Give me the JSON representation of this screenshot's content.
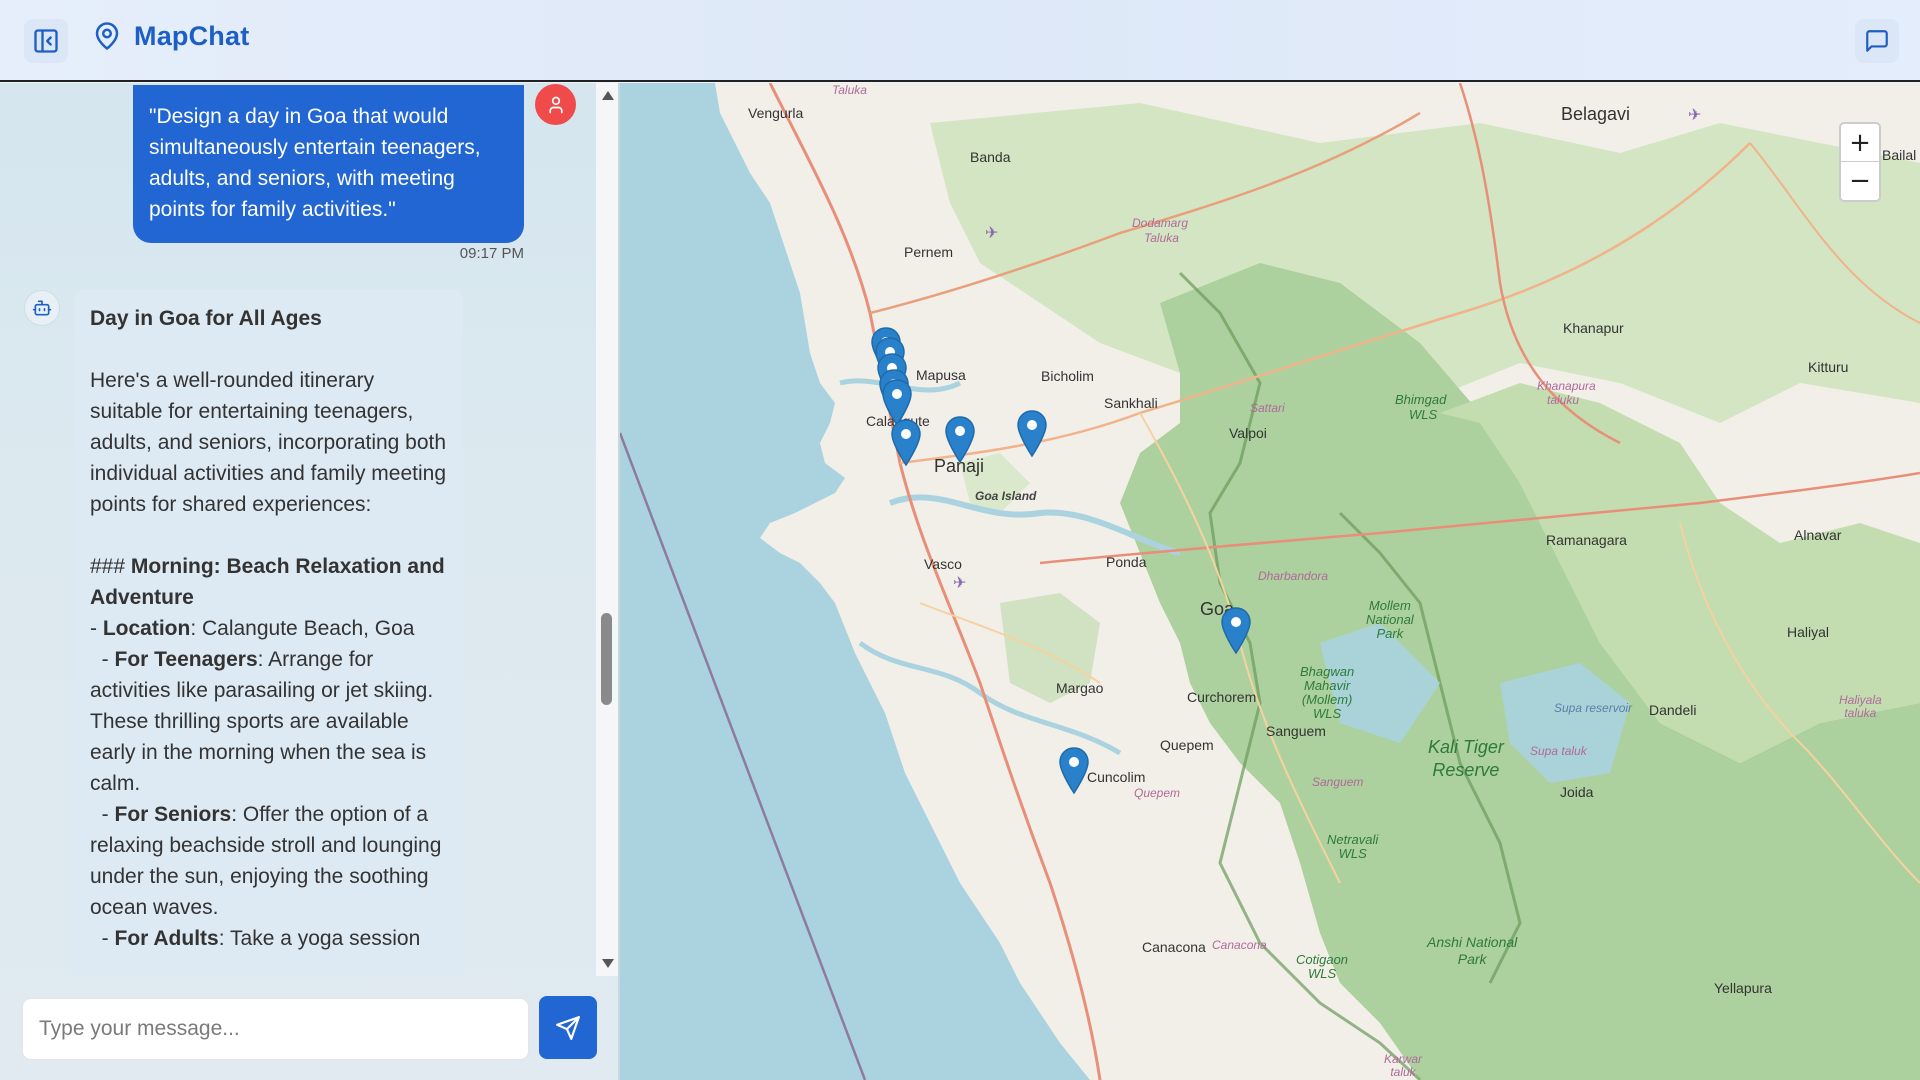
{
  "app": {
    "title": "MapChat"
  },
  "header": {
    "sidebar_toggle_icon": "sidebar-collapse-icon",
    "logo_icon": "map-pin-icon",
    "chat_icon": "message-square-icon"
  },
  "chat": {
    "user_message": "\"Design a day in Goa that would simultaneously entertain teenagers, adults, and seniors, with meeting points for family activities.\"",
    "user_time": "09:17 PM",
    "bot": {
      "title": "Day in Goa for All Ages",
      "intro": "Here's a well-rounded itinerary suitable for entertaining teenagers, adults, and seniors, incorporating both individual activities and family meeting points for shared experiences:",
      "section_prefix": "### ",
      "section_title": "Morning: Beach Relaxation and Adventure",
      "location_label": "Location",
      "location_value": ": Calangute Beach, Goa",
      "teen_label": "For Teenagers",
      "teen_text": ": Arrange for activities like parasailing or jet skiing. These thrilling sports are available early in the morning when the sea is calm.",
      "senior_label": "For Seniors",
      "senior_text": ": Offer the option of a relaxing beachside stroll and lounging under the sun, enjoying the soothing ocean waves.",
      "adult_label": "For Adults",
      "adult_text": ": Take a yoga session"
    }
  },
  "composer": {
    "placeholder": "Type your message...",
    "send_icon": "send-icon"
  },
  "map": {
    "zoom_in": "+",
    "zoom_out": "−",
    "labels": {
      "taluka": "Taluka",
      "vengurla": "Vengurla",
      "banda": "Banda",
      "belagavi": "Belagavi",
      "bailal": "Bailal",
      "dodamarg": "Dodamarg",
      "taluka2": "Taluka",
      "pernem": "Pernem",
      "khanapur": "Khanapur",
      "mapusa": "Mapusa",
      "bicholim": "Bicholim",
      "kitturu": "Kitturu",
      "sattari": "Sattari",
      "bhimgad": "Bhimgad",
      "wls": "WLS",
      "khanapura": "Khanapura",
      "taluku": "taluku",
      "sankhali": "Sankhali",
      "calangute": "Calangute",
      "valpoi": "Valpoi",
      "panaji": "Panaji",
      "goa_island": "Goa Island",
      "ramanagara": "Ramanagara",
      "alnavar": "Alnavar",
      "vasco": "Vasco",
      "ponda": "Ponda",
      "dharbandora": "Dharbandora",
      "goa": "Goa",
      "mollem_np": "Mollem\nNational\nPark",
      "haliyal": "Haliyal",
      "bhagwan": "Bhagwan\nMahavir\n(Mollem)\nWLS",
      "margao": "Margao",
      "curchorem": "Curchorem",
      "sanguem": "Sanguem",
      "supa_reservoir": "Supa reservoir",
      "dandeli": "Dandeli",
      "haliyala_taluka": "Haliyala\ntaluka",
      "quepem": "Quepem",
      "kali_tiger": "Kali Tiger\nReserve",
      "supa_taluk": "Supa taluk",
      "cuncolim": "Cuncolim",
      "quepem2": "Quepem",
      "sanguem2": "Sanguem",
      "joida": "Joida",
      "netravali": "Netravali\nWLS",
      "anshi": "Anshi National\nPark",
      "canacona": "Canacona",
      "canacona2": "Canacona",
      "cotigaon": "Cotigaon\nWLS",
      "yellapura": "Yellapura",
      "karwar": "Karwar\ntaluk"
    }
  },
  "colors": {
    "brand": "#1d5fc4",
    "user_bubble": "#2166d2",
    "user_avatar": "#ef4b4b",
    "sea": "#aad3df",
    "land": "#f2efe9",
    "forest": "#add19e",
    "marker": "#2a81cb"
  }
}
